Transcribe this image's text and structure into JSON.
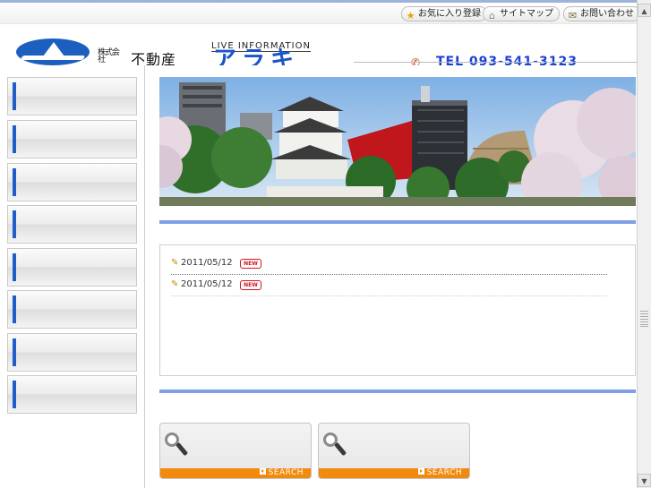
{
  "utility_nav": {
    "favorites_label": "お気に入り登録",
    "sitemap_label": "サイトマップ",
    "contact_label": "お問い合わせ"
  },
  "header": {
    "company_sub": "株式会社",
    "company_name": "不動産",
    "tagline": "LIVE INFORMATION",
    "brand": "アラキ",
    "tel": "TEL 093-541-3123"
  },
  "sidebar": {
    "items": [
      {
        "label": ""
      },
      {
        "label": ""
      },
      {
        "label": ""
      },
      {
        "label": ""
      },
      {
        "label": ""
      },
      {
        "label": ""
      },
      {
        "label": ""
      },
      {
        "label": ""
      }
    ]
  },
  "news": {
    "items": [
      {
        "date": "2011/05/12",
        "badge": "NEW",
        "title": ""
      },
      {
        "date": "2011/05/12",
        "badge": "NEW",
        "title": ""
      }
    ]
  },
  "search_boxes": [
    {
      "label": "SEARCH"
    },
    {
      "label": "SEARCH"
    }
  ],
  "colors": {
    "accent_blue": "#1e5ec9",
    "rule_blue": "#7f9fe6",
    "search_orange": "#f28a0e",
    "new_red": "#d4141c"
  }
}
